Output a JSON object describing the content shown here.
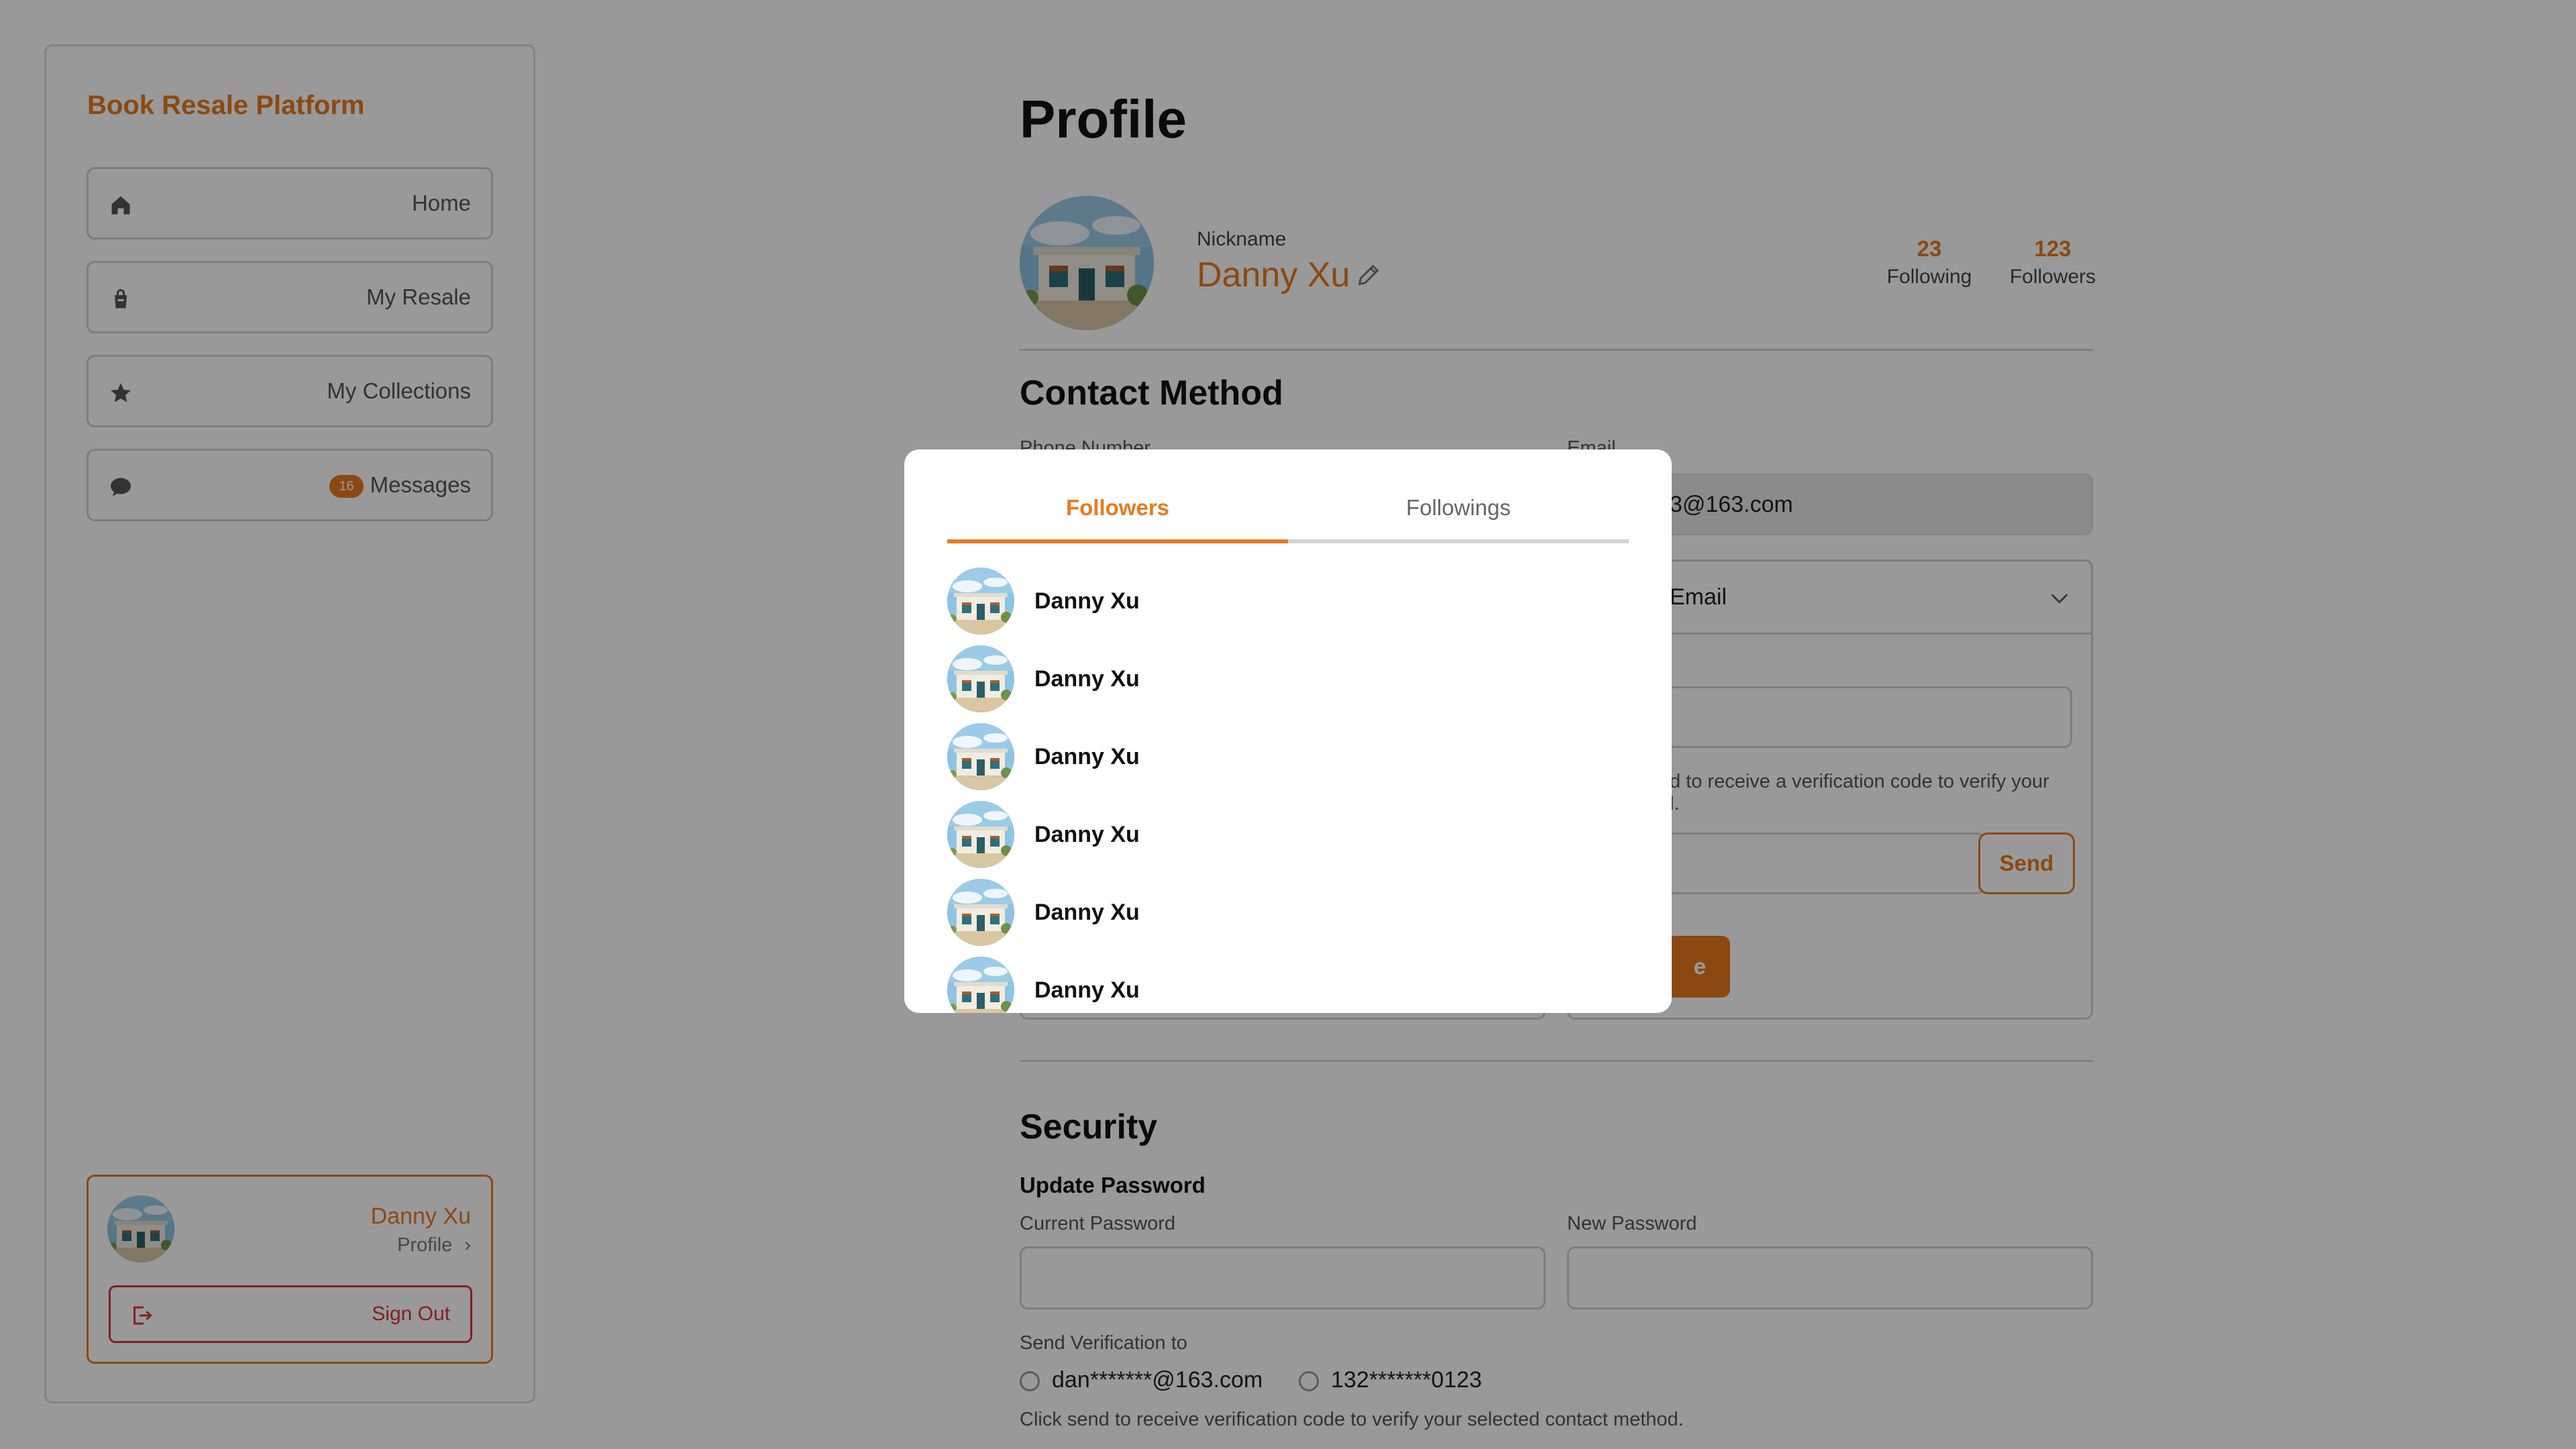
{
  "app": {
    "brand": "Book Resale Platform"
  },
  "sidebar": {
    "items": [
      {
        "label": "Home",
        "icon": "home-icon"
      },
      {
        "label": "My Resale",
        "icon": "bag-icon"
      },
      {
        "label": "My Collections",
        "icon": "star-icon"
      },
      {
        "label": "Messages",
        "icon": "chat-icon",
        "badge": "16"
      }
    ],
    "user": {
      "name": "Danny Xu",
      "profile_link": "Profile",
      "profile_chevron": "›",
      "sign_out": "Sign Out"
    }
  },
  "profile": {
    "title": "Profile",
    "nickname_label": "Nickname",
    "nickname": "Danny Xu",
    "following_count": "23",
    "following_label": "Following",
    "followers_count": "123",
    "followers_label": "Followers"
  },
  "contact": {
    "title": "Contact Method",
    "phone_label": "Phone Number",
    "email_label": "Email",
    "email_value_visible": "3@163.com",
    "accordion_title_visible": "Email",
    "hint_visible": "d to receive a verification code to verify your",
    "hint_visible_2": "l.",
    "send_label": "Send",
    "primary_visible": "e"
  },
  "security": {
    "title": "Security",
    "update_password": "Update Password",
    "current_password_label": "Current Password",
    "new_password_label": "New Password",
    "send_to_label": "Send Verification to",
    "option_email": "dan*******@163.com",
    "option_phone": "132*******0123",
    "hint": "Click send to receive verification code to verify your selected contact method."
  },
  "modal": {
    "tabs": [
      "Followers",
      "Followings"
    ],
    "active_tab": "Followers",
    "list": [
      {
        "name": "Danny Xu"
      },
      {
        "name": "Danny Xu"
      },
      {
        "name": "Danny Xu"
      },
      {
        "name": "Danny Xu"
      },
      {
        "name": "Danny Xu"
      },
      {
        "name": "Danny Xu"
      }
    ]
  },
  "colors": {
    "accent": "#e87a1f",
    "danger": "#d9363e",
    "overlay": "rgba(0,0,0,0.4)"
  }
}
